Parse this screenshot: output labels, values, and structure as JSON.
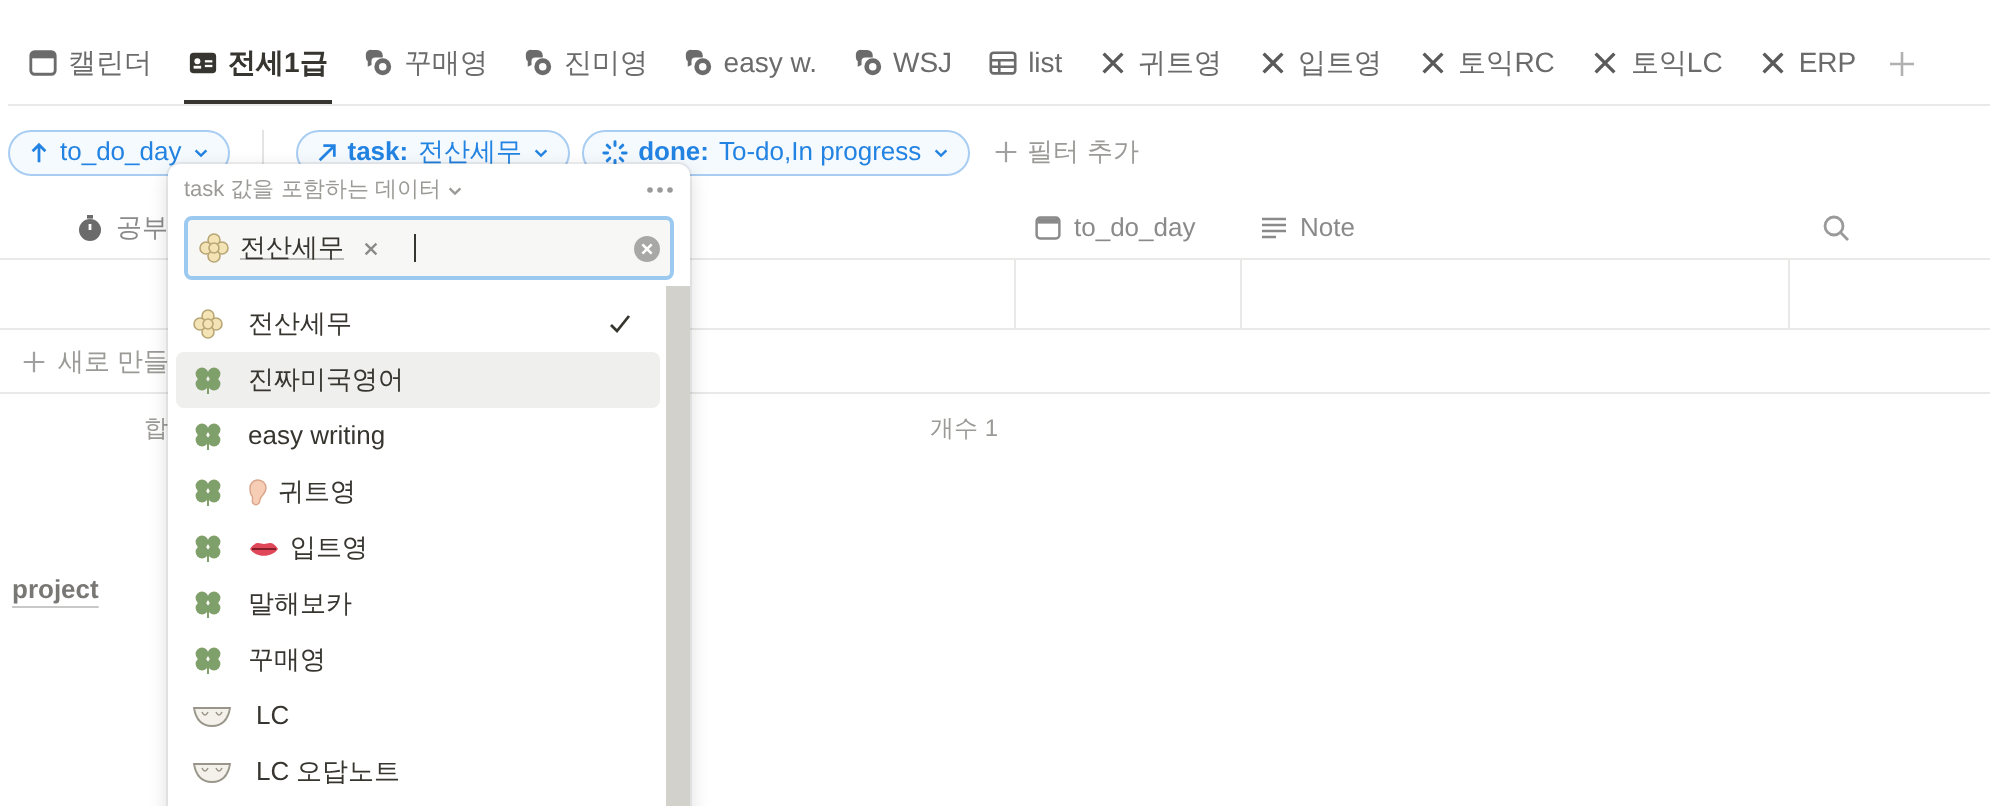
{
  "tabs": [
    {
      "label": "캘린더",
      "kind": "calendar",
      "selected": false
    },
    {
      "label": "전세1급",
      "kind": "card",
      "selected": true
    },
    {
      "label": "꾸매영",
      "kind": "chat",
      "selected": false
    },
    {
      "label": "진미영",
      "kind": "chat",
      "selected": false
    },
    {
      "label": "easy w.",
      "kind": "chat",
      "selected": false
    },
    {
      "label": "WSJ",
      "kind": "chat",
      "selected": false
    },
    {
      "label": "list",
      "kind": "table",
      "selected": false
    },
    {
      "label": "귀트영",
      "kind": "cross",
      "selected": false
    },
    {
      "label": "입트영",
      "kind": "cross",
      "selected": false
    },
    {
      "label": "토익RC",
      "kind": "cross",
      "selected": false
    },
    {
      "label": "토익LC",
      "kind": "cross",
      "selected": false
    },
    {
      "label": "ERP",
      "kind": "cross",
      "selected": false
    }
  ],
  "filters": [
    {
      "kind": "sort",
      "label": "to_do_day"
    },
    {
      "kind": "relation",
      "name": "task:",
      "value": "전산세무"
    },
    {
      "kind": "status",
      "name": "done:",
      "value": "To-do,In progress"
    }
  ],
  "add_filter": "필터 추가",
  "table": {
    "columns": [
      {
        "kind": "study",
        "label": "공부"
      },
      {
        "kind": "date",
        "label": "to_do_day"
      },
      {
        "kind": "text",
        "label": "Note"
      }
    ],
    "new_row": "새로 만들",
    "sum_label": "합",
    "count": "개수 1"
  },
  "group": "project",
  "popup": {
    "title": "task 값을 포함하는 데이터",
    "tag": "전산세무",
    "options": [
      {
        "label": "전산세무",
        "kind": "flower",
        "checked": true,
        "selected": false
      },
      {
        "label": "진짜미국영어",
        "kind": "clover",
        "checked": false,
        "selected": true
      },
      {
        "label": "easy writing",
        "kind": "clover",
        "checked": false,
        "selected": false
      },
      {
        "label": "귀트영",
        "kind": "clover_ear",
        "checked": false,
        "selected": false
      },
      {
        "label": "입트영",
        "kind": "clover_lips",
        "checked": false,
        "selected": false
      },
      {
        "label": "말해보카",
        "kind": "clover",
        "checked": false,
        "selected": false
      },
      {
        "label": "꾸매영",
        "kind": "clover",
        "checked": false,
        "selected": false
      },
      {
        "label": "LC",
        "kind": "bowl",
        "checked": false,
        "selected": false
      },
      {
        "label": "LC 오답노트",
        "kind": "bowl",
        "checked": false,
        "selected": false
      }
    ]
  }
}
